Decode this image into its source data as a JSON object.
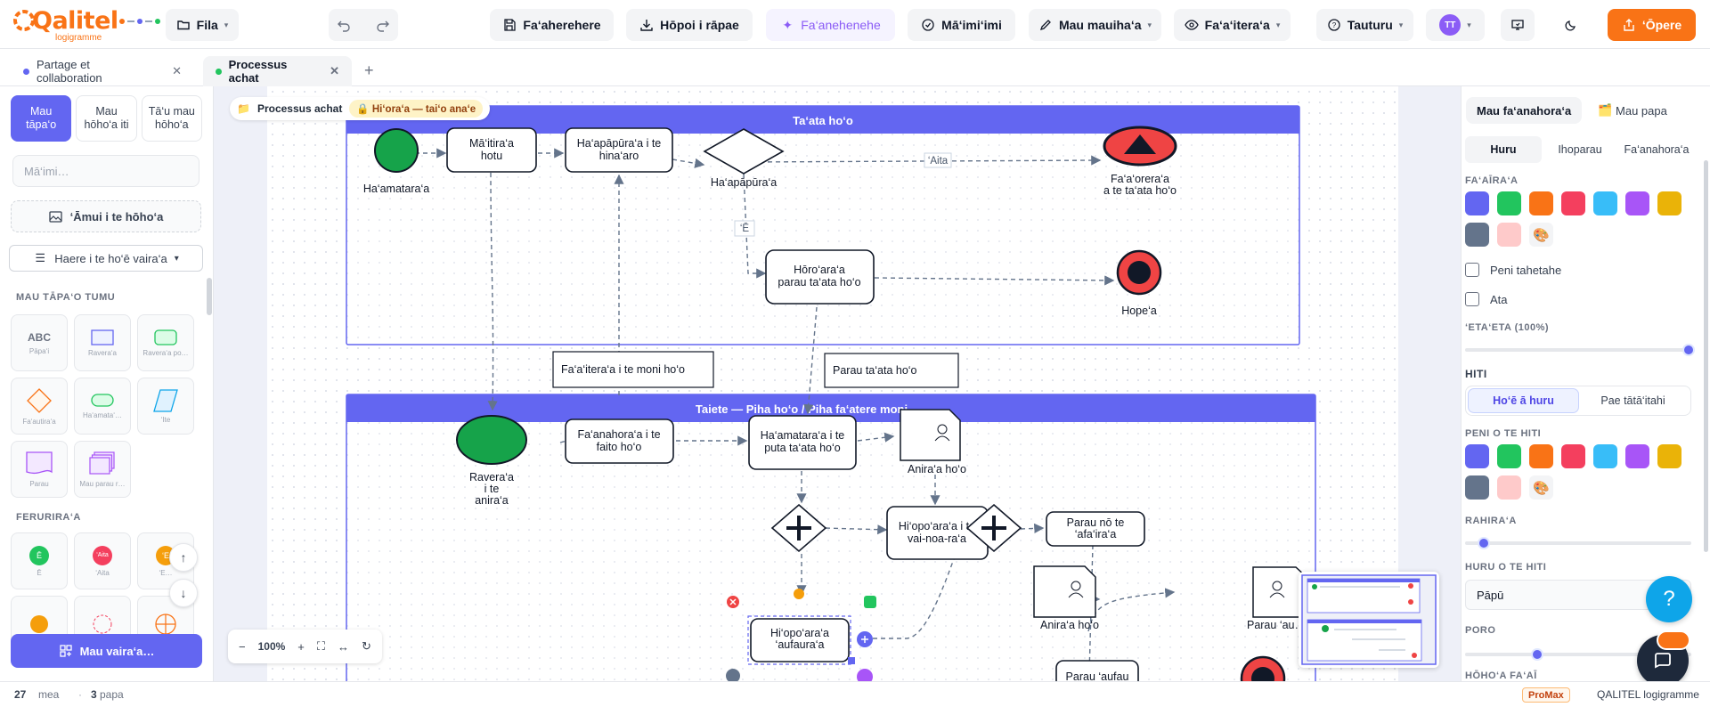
{
  "app": {
    "logo_text": "Qalitel",
    "logo_subtitle": "logigramme"
  },
  "topbar": {
    "file_label": "Fila",
    "save_label": "Fa‘aherehere",
    "download_label": "Hōpoi i rāpae",
    "ai_label": "Fa‘anehenehe",
    "check_label": "Mā‘imi‘imi",
    "model_label": "Mau mauiha‘a",
    "view_label": "Fa‘a‘itera‘a",
    "help_label": "Tauturu",
    "avatar_initials": "TT",
    "share_label": "‘Ōpere"
  },
  "tabs": [
    {
      "label": "Partage et collaboration",
      "dot_color": "#6366f1"
    },
    {
      "label": "Processus achat",
      "dot_color": "#22c55e"
    }
  ],
  "left_panel": {
    "mode_tabs": [
      "Mau tāpa‘o",
      "Mau hōho‘a iti",
      "Tā‘u mau hōho‘a"
    ],
    "search_placeholder": "Mā‘imi…",
    "import_label": "‘Āmui i te hōho‘a",
    "sort_label": "Haere i te ho‘ē vaira‘a",
    "section_basic": "MAU TĀPA‘O TUMU",
    "basic_shapes": [
      {
        "label": "Pāpa‘i",
        "glyph": "ABC"
      },
      {
        "label": "Ravera‘a",
        "glyph": ""
      },
      {
        "label": "Ravera‘a po…",
        "glyph": ""
      },
      {
        "label": "Fa‘autira‘a",
        "glyph": ""
      },
      {
        "label": "Ha‘amata‘…",
        "glyph": ""
      },
      {
        "label": "‘Ite",
        "glyph": ""
      },
      {
        "label": "Parau",
        "glyph": ""
      },
      {
        "label": "Mau parau r…",
        "glyph": ""
      }
    ],
    "section_flow": "FERURIRA‘A",
    "flow_shapes": [
      {
        "label": "Ē",
        "glyph": "Ē"
      },
      {
        "label": "‘Aita",
        "glyph": "‘Aita"
      },
      {
        "label": "‘E…",
        "glyph": "‘E"
      }
    ],
    "new_diagram_label": "Mau vaira‘a…"
  },
  "canvas": {
    "breadcrumb_folder": "Processus achat",
    "lock_badge": "Hi‘ora‘a — tai‘o ana‘e",
    "zoom": "100%",
    "lane_top_title": "Ta‘ata ho‘o",
    "lane_bottom_title": "Taiete — Piha ho‘o / Piha fa‘atere moni",
    "nodes": {
      "start1": "Ha‘amatara‘a",
      "t_need1": "Mā‘itira‘a",
      "t_need2": "hotu",
      "t_cmp1": "Ha‘apāpūra‘a i te",
      "t_cmp2": "hina‘aro",
      "gw1": "Ha‘apāpūra‘a",
      "end_signal1": "Fa‘a‘orera‘a",
      "end_signal2": "a te ta‘ata ho‘o",
      "label_no": "‘Aita",
      "label_yes": "‘Ē",
      "t_order1": "Hōro‘ara‘a",
      "t_order2": "parau ta‘ata ho‘o",
      "end1": "Hope‘a",
      "msg1": "Fa‘a‘itera‘a i te moni ho‘o",
      "msg2": "Parau ta‘ata ho‘o",
      "start2a": "Ravera‘a",
      "start2b": "i te",
      "start2c": "anira‘a",
      "t_receive1": "Fa‘anahora‘a i te",
      "t_receive2": "faito ho‘o",
      "t_check1": "Ha‘amatara‘a i te",
      "t_check2": "puta ta‘ata ho‘o",
      "doc1": "Anira‘a ho‘o",
      "t_verify1": "Hi‘opo‘ara‘a i te",
      "t_verify2": "vai-noa-ra‘a",
      "t_note1": "Parau nō te",
      "t_note2": "‘afa‘ira‘a",
      "doc2": "Anira‘a ho‘o",
      "doc3": "Parau ‘au…",
      "t_pay1": "Hi‘opo‘ara‘a",
      "t_pay2": "‘aufaura‘a",
      "t_last": "Parau ‘aufau"
    }
  },
  "right_panel": {
    "tabs": [
      "Mau fa‘anahora‘a",
      "Mau papa"
    ],
    "subtabs": [
      "Huru",
      "Ihoparau",
      "Fa‘anahora‘a"
    ],
    "fill_label": "FA‘AĪRA‘A",
    "fill_colors": [
      "#6366f1",
      "#22c55e",
      "#f97316",
      "#f43f5e",
      "#38bdf8",
      "#a855f7",
      "#eab308",
      "#64748b",
      "#fecaca"
    ],
    "gradient_label": "Peni tahetahe",
    "shadow_label": "Ata",
    "opacity_label": "‘ETA‘ETA (100%)",
    "opacity_value": 1.0,
    "line_label": "HITI",
    "line_modes": [
      "Ho‘ē ā huru",
      "Pae tātā‘itahi"
    ],
    "line_color_label": "PENI O TE HITI",
    "line_colors": [
      "#6366f1",
      "#22c55e",
      "#f97316",
      "#f43f5e",
      "#38bdf8",
      "#a855f7",
      "#eab308",
      "#64748b",
      "#fecaca"
    ],
    "width_label": "RAHIRA‘A",
    "width_value": 0.08,
    "style_label": "HURU O TE HITI",
    "style_value": "Pāpū",
    "radius_label": "PORO",
    "radius_value": 0.3,
    "text_label": "HŌHO‘A FA‘AĪ"
  },
  "statusbar": {
    "elements_count": "27",
    "elements_label": "mea",
    "layers_count": "3",
    "layers_label": "papa",
    "plan": "ProMax",
    "product": "QALITEL logigramme"
  }
}
